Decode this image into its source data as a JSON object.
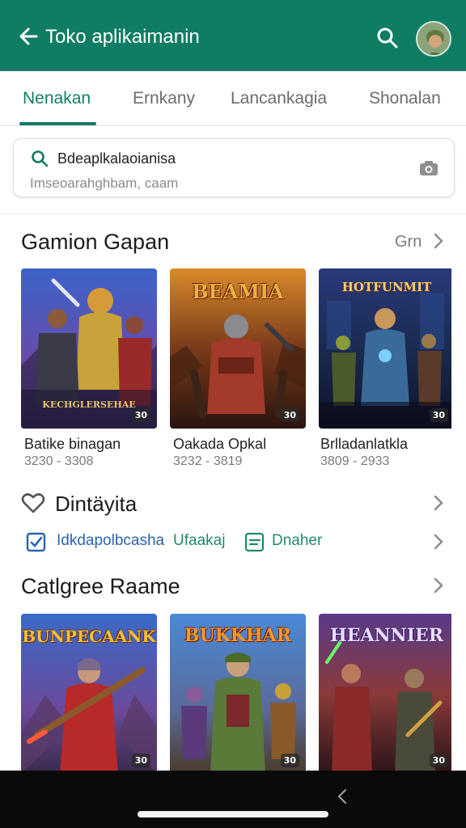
{
  "appbar": {
    "title": "Toko aplikaimanin",
    "back_icon": "arrow-left-icon",
    "search_icon": "search-icon",
    "avatar_icon": "profile-avatar",
    "background": "#0f7d63"
  },
  "tabs": [
    {
      "label": "Nenakan",
      "active": true
    },
    {
      "label": "Ernkany",
      "active": false
    },
    {
      "label": "Lancankagia",
      "active": false
    },
    {
      "label": "Shonalan",
      "active": false
    }
  ],
  "search": {
    "query": "Bdeaplkalaoianisa",
    "hint": "Imseoarahghbam, caam",
    "camera_icon": "camera-icon"
  },
  "section1": {
    "title": "Gamion Gapan",
    "more_label": "Grn",
    "cards": [
      {
        "name": "Batike binagan",
        "range": "3230 - 3308",
        "banner": "KECHGLERSEHAE",
        "badge": "30"
      },
      {
        "name": "Oakada Opkal",
        "range": "3232 - 3819",
        "banner": "BEAMIA",
        "badge": "30"
      },
      {
        "name": "Brlladanlatkla",
        "range": "3809 - 2933",
        "banner": "HOTFUNMIT",
        "badge": "30"
      }
    ]
  },
  "favorites": {
    "title": "Dintäyita",
    "heart_icon": "heart-icon",
    "chips": [
      {
        "label": "Idkdapolbcasha",
        "icon": "checkbox-icon"
      },
      {
        "label": "Ufaakaj",
        "icon": ""
      },
      {
        "label": "Dnaher",
        "icon": "list-icon"
      }
    ]
  },
  "section2": {
    "title": "Catlgree Raame",
    "cards": [
      {
        "banner": "BUNPECAANK",
        "badge": "30"
      },
      {
        "banner": "BUKKHAR",
        "badge": "30"
      },
      {
        "banner": "HEANNIER",
        "badge": "30"
      }
    ]
  },
  "colors": {
    "accent": "#0f7d63",
    "chip_blue": "#2a63b0",
    "chip_teal": "#1f8a6a"
  }
}
